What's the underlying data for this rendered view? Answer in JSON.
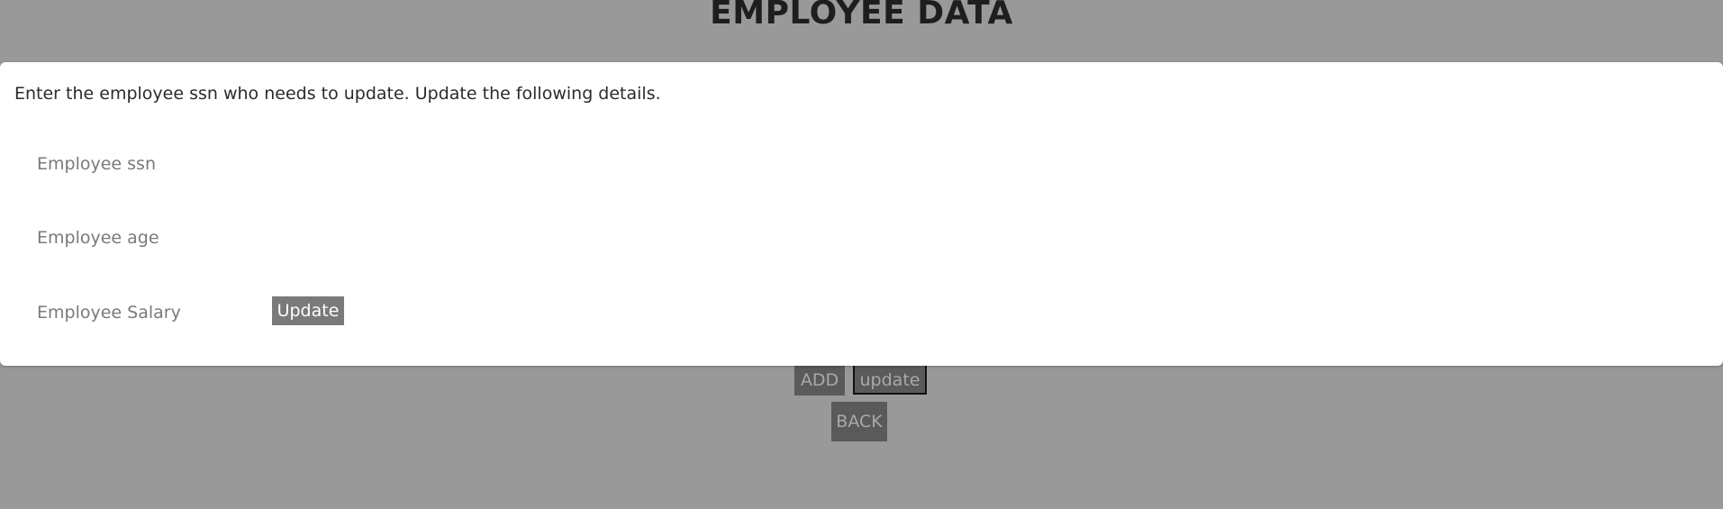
{
  "page": {
    "title": "EMPLOYEE DATA"
  },
  "modal": {
    "instruction": "Enter the employee ssn who needs to update. Update the following details.",
    "fields": {
      "ssn": {
        "placeholder": "Employee ssn",
        "value": ""
      },
      "age": {
        "placeholder": "Employee age",
        "value": ""
      },
      "salary": {
        "placeholder": "Employee Salary",
        "value": ""
      }
    },
    "submit_label": "Update"
  },
  "background_actions": {
    "add_label": "ADD",
    "update_label": "update",
    "back_label": "BACK"
  },
  "colors": {
    "overlay": "#999999",
    "modal_background": "#ffffff",
    "dark_button": "#5a5a5a",
    "submit_button": "#7a7a7a",
    "title_text": "#1e1e1e"
  }
}
